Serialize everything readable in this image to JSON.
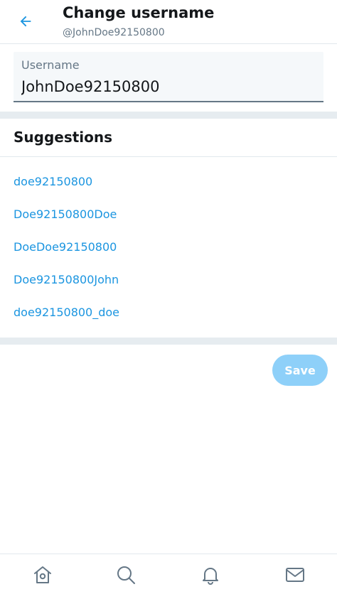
{
  "header": {
    "title": "Change username",
    "handle": "@JohnDoe92150800",
    "back_icon": "arrow-left-icon"
  },
  "username_field": {
    "label": "Username",
    "value": "JohnDoe92150800"
  },
  "suggestions": {
    "title": "Suggestions",
    "items": [
      "doe92150800",
      "Doe92150800Doe",
      "DoeDoe92150800",
      "Doe92150800John",
      "doe92150800_doe"
    ]
  },
  "actions": {
    "save_label": "Save"
  },
  "bottom_nav": {
    "icons": [
      "home-icon",
      "search-icon",
      "notifications-icon",
      "messages-icon"
    ]
  },
  "colors": {
    "accent": "#1b95e0",
    "save_disabled": "#8ed0f9",
    "divider": "#e6ecf0"
  }
}
